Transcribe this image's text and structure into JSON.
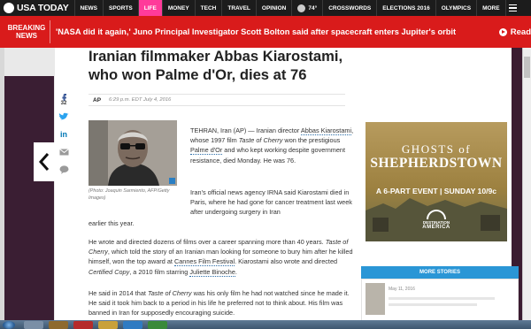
{
  "header": {
    "logo_text": "USA TODAY",
    "nav": [
      {
        "label": "NEWS"
      },
      {
        "label": "SPORTS"
      },
      {
        "label": "LIFE"
      },
      {
        "label": "MONEY"
      },
      {
        "label": "TECH"
      },
      {
        "label": "TRAVEL"
      },
      {
        "label": "OPINION"
      },
      {
        "label": "74°"
      },
      {
        "label": "CROSSWORDS"
      },
      {
        "label": "ELECTIONS 2016"
      },
      {
        "label": "OLYMPICS"
      },
      {
        "label": "MORE"
      }
    ]
  },
  "breaking": {
    "label_line1": "BREAKING",
    "label_line2": "NEWS",
    "headline": "'NASA did it again,' Juno Principal Investigator Scott Bolton said after spacecraft enters Jupiter's orbit",
    "read_label": "Read"
  },
  "share": {
    "count": "32"
  },
  "article": {
    "title": "Iranian filmmaker Abbas Kiarostami, who won Palme d'Or, dies at 76",
    "source": "AP",
    "date": "6:29 p.m. EDT July 4, 2016",
    "photo_credit": "(Photo: Joaquin Sarmiento, AFP/Getty Images)",
    "p1_a": "TEHRAN, Iran (AP) — Iranian director ",
    "p1_link1": "Abbas Kiarostami",
    "p1_b": ", whose 1997 film ",
    "p1_italic": "Taste of Cherry",
    "p1_c": " won the prestigious ",
    "p1_link2": "Palme d'Or",
    "p1_d": " and who kept working despite government resistance, died Monday. He was 76.",
    "p2": "Iran's official news agency IRNA said Kiarostami died in Paris, where he had gone for cancer treatment last week after undergoing surgery in Iran",
    "p2_cont": "earlier this year.",
    "p3_a": "He wrote and directed dozens of films over a career spanning more than 40 years. ",
    "p3_italic1": "Taste of Cherry",
    "p3_b": ", which told the story of an Iranian man looking for someone to bury him after he killed himself, won the top award at ",
    "p3_link1": "Cannes Film Festival",
    "p3_c": ". Kiarostami also wrote and directed ",
    "p3_italic2": "Certified Copy",
    "p3_d": ", a 2010 film starring ",
    "p3_link2": "Juliette Binoche",
    "p3_e": ".",
    "p4_a": "He said in 2014 that ",
    "p4_italic": "Taste of Cherry",
    "p4_b": " was his only film he had not watched since he made it. He said it took him back to a period in his life he preferred not to think about. His film was banned in Iran for supposedly encouraging suicide."
  },
  "ad": {
    "line1": "GHOSTS of",
    "line2": "SHEPHERDSTOWN",
    "line3": "A 6-PART EVENT | SUNDAY 10/9c",
    "logo_a": "DESTINATION",
    "logo_b": "AMERICA"
  },
  "sidebar": {
    "more_stories": "MORE STORIES",
    "story_date": "May 11, 2016"
  },
  "colors": {
    "nav_bg": "#1c1c1c",
    "life_accent": "#ff3b9a",
    "breaking_red": "#d91b1b",
    "more_stories_blue": "#2a96d6"
  }
}
